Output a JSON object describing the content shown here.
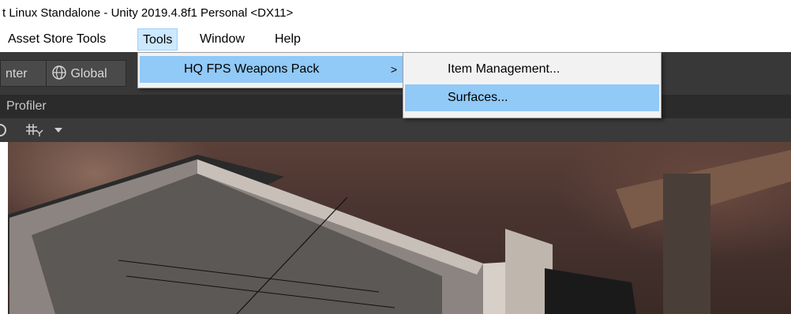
{
  "window": {
    "title": "t Linux Standalone - Unity 2019.4.8f1 Personal <DX11>"
  },
  "menubar": {
    "items": [
      {
        "label": "Asset Store Tools"
      },
      {
        "label": "Tools"
      },
      {
        "label": "Window"
      },
      {
        "label": "Help"
      }
    ]
  },
  "toolbar": {
    "pivot_label": "nter",
    "global_label": "Global",
    "globe_icon": "globe-icon"
  },
  "tabs": {
    "profiler_label": "Profiler"
  },
  "scene_toolbar": {
    "gizmo_icon": "gizmo-icon",
    "dropdown_icon": "chevron-down-icon"
  },
  "tools_menu": {
    "items": [
      {
        "label": "HQ FPS Weapons Pack",
        "submenu_arrow": ">"
      }
    ]
  },
  "submenu": {
    "items": [
      {
        "label": "Item Management..."
      },
      {
        "label": "Surfaces..."
      }
    ]
  },
  "colors": {
    "menu_highlight": "#91c9f7",
    "menubar_active": "#cce8ff",
    "editor_dark": "#383838"
  }
}
